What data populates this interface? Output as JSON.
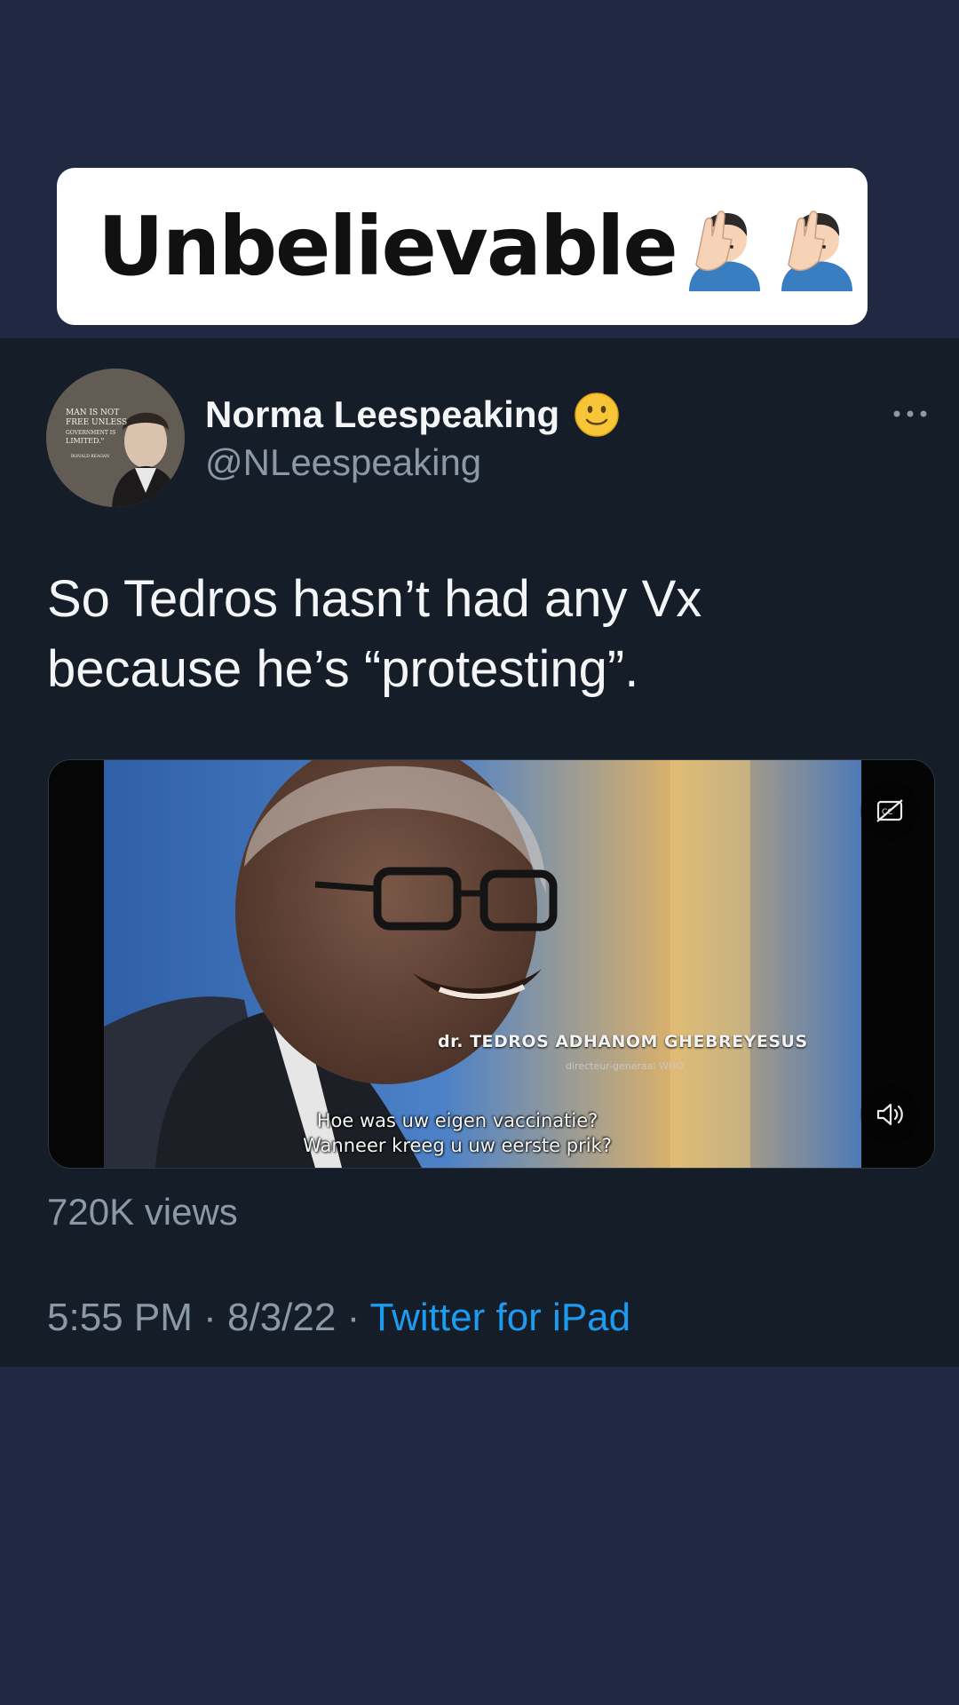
{
  "caption": {
    "text": "Unbelievable",
    "emoji": [
      "facepalm-man-icon",
      "facepalm-man-icon"
    ]
  },
  "tweet": {
    "display_name": "Norma Leespeaking",
    "name_emoji": "slightly-smiling-face-icon",
    "handle": "@NLeespeaking",
    "more_icon": "more-horizontal-icon",
    "text_line1": "So Tedros hasn’t had any Vx",
    "text_line2": "because he’s “protesting”.",
    "avatar_quote": {
      "line1": "MAN IS NOT",
      "line2": "FREE UNLESS",
      "line3": "GOVERNMENT IS",
      "line4": "LIMITED.\"",
      "attribution": "RONALD REAGAN"
    },
    "media": {
      "overlay_title": "dr. TEDROS ADHANOM GHEBREYESUS",
      "overlay_subtitle": "directeur-generaal WHO",
      "caption_line1": "Hoe was uw eigen vaccinatie?",
      "caption_line2": "Wanneer kreeg u uw eerste prik?",
      "cc_icon": "closed-captions-off-icon",
      "sound_icon": "speaker-icon"
    },
    "views": "720K views",
    "time": "5:55 PM",
    "separator": "·",
    "date": "8/3/22",
    "source": "Twitter for iPad"
  },
  "colors": {
    "page_background": "#212942",
    "card_background": "#151d29",
    "primary_text": "#f3f5f7",
    "secondary_text": "#8b98a5",
    "link": "#1d9bf0"
  }
}
